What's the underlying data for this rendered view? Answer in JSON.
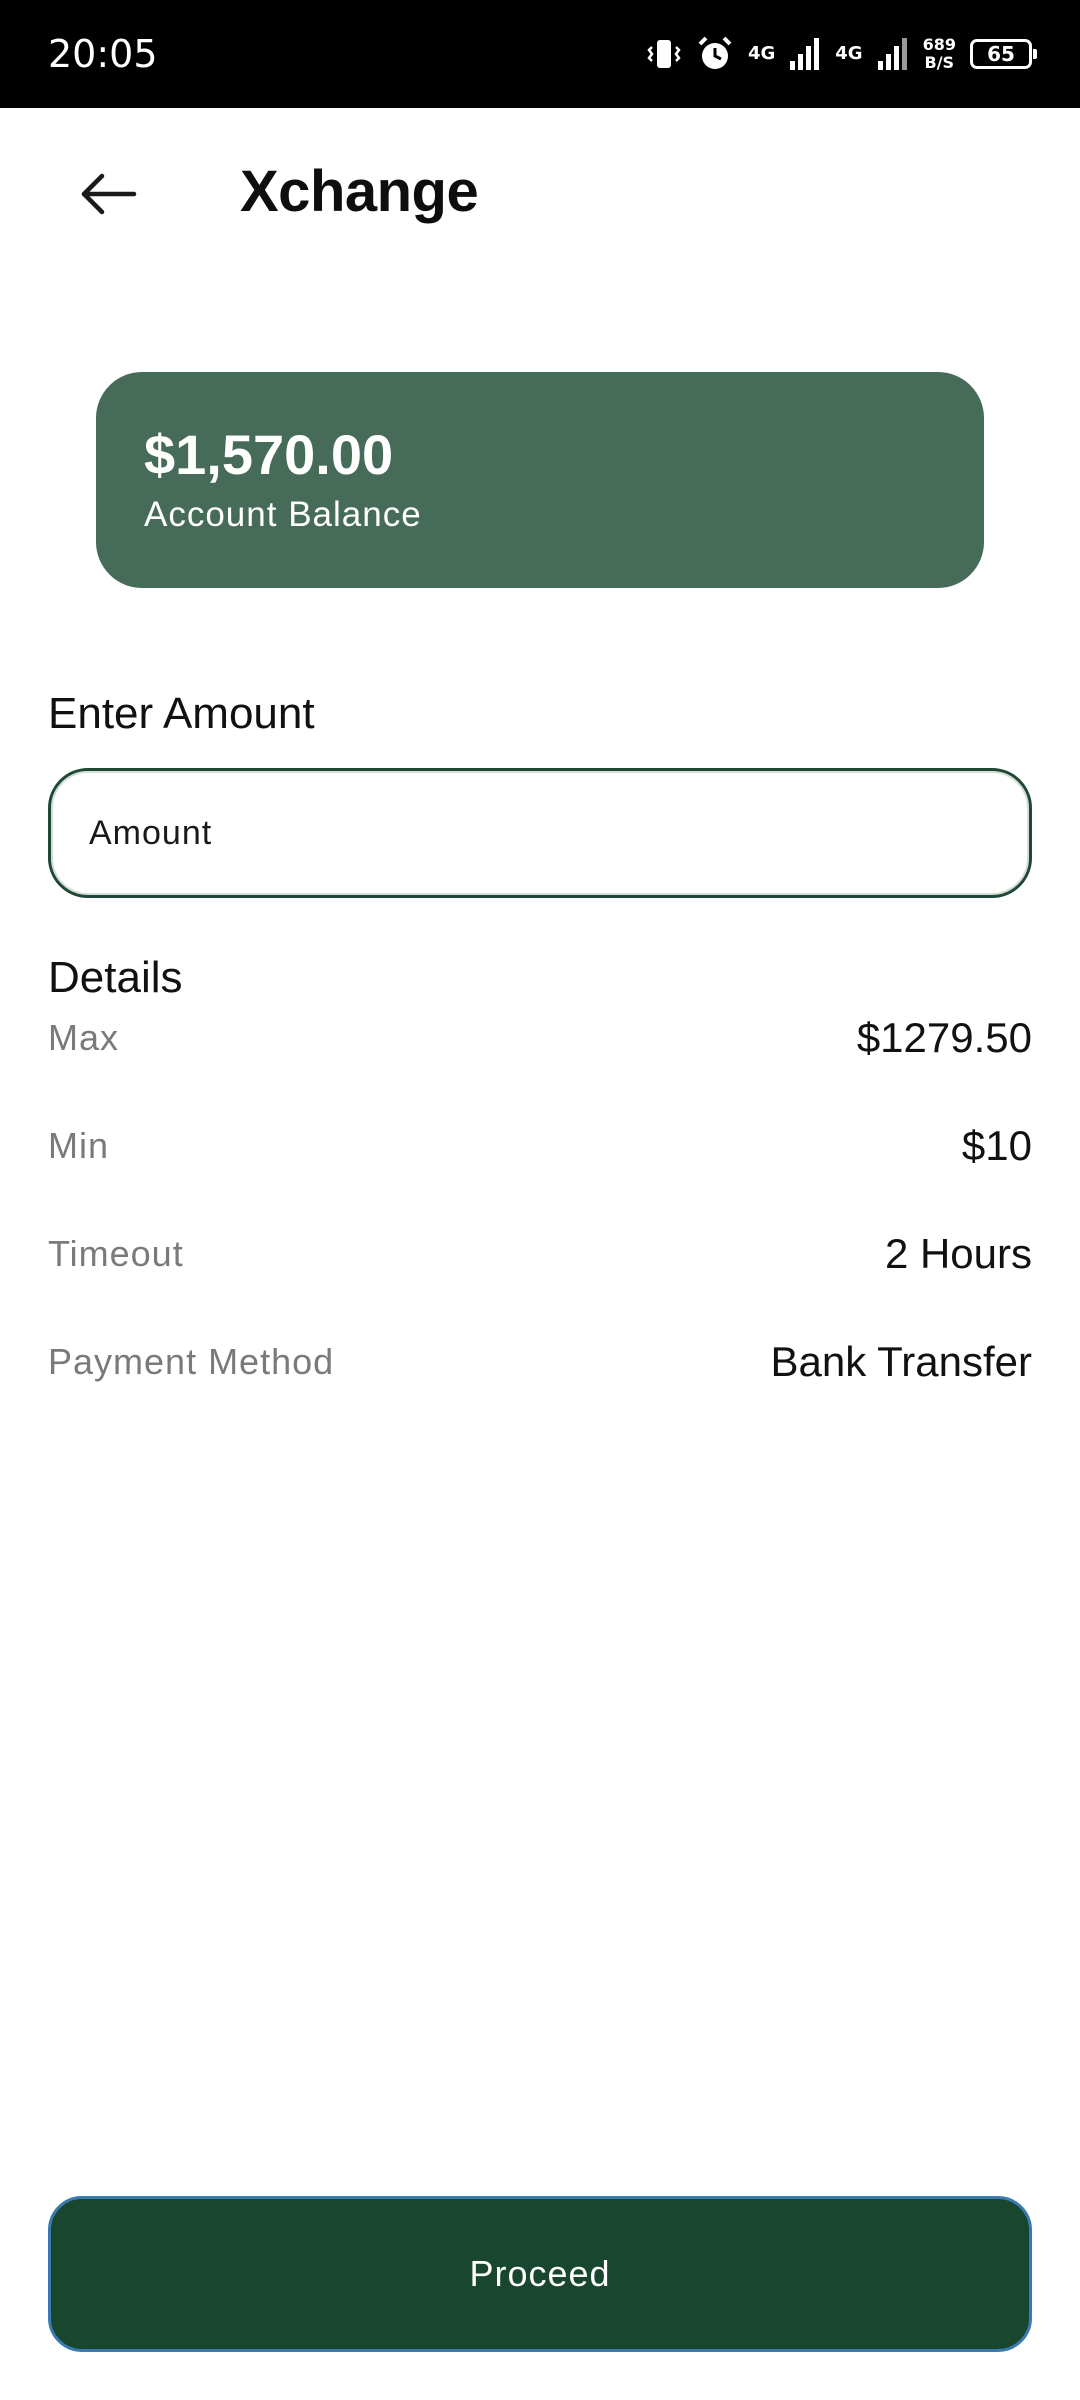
{
  "status_bar": {
    "time": "20:05",
    "network_1": "4G",
    "network_2": "4G",
    "speed_value": "689",
    "speed_unit": "B/S",
    "battery": "65",
    "icons": [
      "vibrate-icon",
      "alarm-icon",
      "signal-icon",
      "signal-icon",
      "battery-icon"
    ]
  },
  "header": {
    "title": "Xchange",
    "back_icon": "arrow-left-icon"
  },
  "balance_card": {
    "amount": "$1,570.00",
    "label": "Account Balance",
    "color": "#466b59"
  },
  "amount_form": {
    "label": "Enter Amount",
    "placeholder": "Amount",
    "value": ""
  },
  "details": {
    "heading": "Details",
    "rows": [
      {
        "label": "Max",
        "value": "$1279.50"
      },
      {
        "label": "Min",
        "value": "$10"
      },
      {
        "label": "Timeout",
        "value": "2 Hours"
      },
      {
        "label": "Payment Method",
        "value": "Bank Transfer"
      }
    ]
  },
  "actions": {
    "proceed_label": "Proceed",
    "proceed_color": "#18462f"
  }
}
